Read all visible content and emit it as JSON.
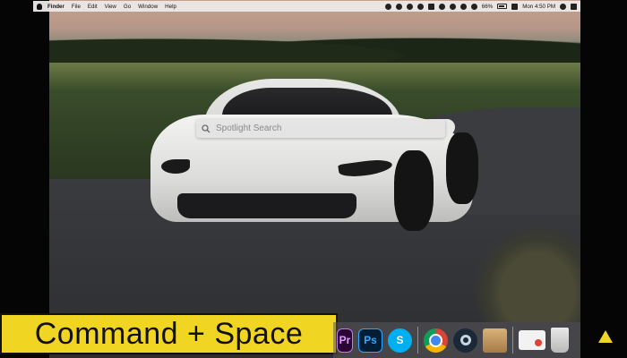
{
  "menubar": {
    "app_name": "Finder",
    "items": [
      "File",
      "Edit",
      "View",
      "Go",
      "Window",
      "Help"
    ],
    "battery": "66%",
    "clock": "Mon 4:50 PM"
  },
  "spotlight": {
    "placeholder": "Spotlight Search"
  },
  "caption": {
    "text": "Command + Space",
    "background_color": "#f1d523"
  },
  "dock": {
    "apps": [
      {
        "name": "premiere-pro",
        "label": "Pr"
      },
      {
        "name": "photoshop",
        "label": "Ps"
      },
      {
        "name": "skype",
        "label": "S"
      },
      {
        "name": "chrome",
        "label": ""
      },
      {
        "name": "steam",
        "label": ""
      },
      {
        "name": "archive-utility",
        "label": ""
      },
      {
        "name": "preview",
        "label": ""
      },
      {
        "name": "trash",
        "label": ""
      }
    ]
  }
}
